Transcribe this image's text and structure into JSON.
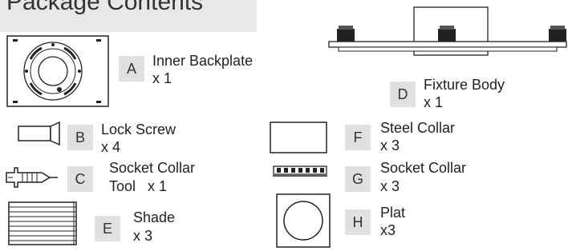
{
  "header": {
    "title": "Package Contents"
  },
  "items": [
    {
      "letter": "A",
      "name": "Inner Backplate",
      "qty": "x 1"
    },
    {
      "letter": "B",
      "name": "Lock Screw",
      "qty": "x 4"
    },
    {
      "letter": "C",
      "name": "Socket Collar",
      "qty": "Tool   x 1"
    },
    {
      "letter": "D",
      "name": "Fixture Body",
      "qty": "x 1"
    },
    {
      "letter": "E",
      "name": "Shade",
      "qty": "x 3"
    },
    {
      "letter": "F",
      "name": "Steel Collar",
      "qty": "x 3"
    },
    {
      "letter": "G",
      "name": "Socket Collar",
      "qty": "x 3"
    },
    {
      "letter": "H",
      "name": "Plat",
      "qty": "x3"
    }
  ]
}
